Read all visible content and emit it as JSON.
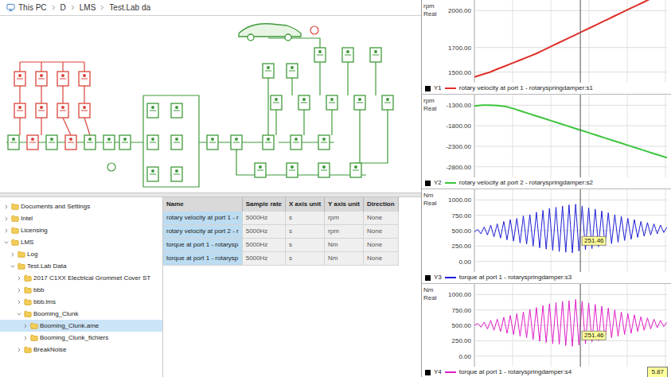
{
  "breadcrumb": [
    "This PC",
    "D",
    "LMS",
    "Test.Lab da"
  ],
  "tree": [
    {
      "label": "Documents and Settings",
      "depth": 0,
      "expanded": false,
      "selected": false
    },
    {
      "label": "Intel",
      "depth": 0,
      "expanded": false,
      "selected": false
    },
    {
      "label": "Licensing",
      "depth": 0,
      "expanded": false,
      "selected": false
    },
    {
      "label": "LMS",
      "depth": 0,
      "expanded": true,
      "selected": false
    },
    {
      "label": "Log",
      "depth": 1,
      "expanded": false,
      "selected": false
    },
    {
      "label": "Test.Lab Data",
      "depth": 1,
      "expanded": true,
      "selected": false
    },
    {
      "label": "2017 C1XX Electrical Grommet Cover ST",
      "depth": 2,
      "expanded": false,
      "selected": false
    },
    {
      "label": "bbb",
      "depth": 2,
      "expanded": false,
      "selected": false
    },
    {
      "label": "bbb.lms",
      "depth": 2,
      "expanded": false,
      "selected": false
    },
    {
      "label": "Booming_Clunk",
      "depth": 2,
      "expanded": true,
      "selected": false
    },
    {
      "label": "Booming_Clunk.ame",
      "depth": 3,
      "expanded": false,
      "selected": true
    },
    {
      "label": "Booming_Clunk_fichiers",
      "depth": 3,
      "expanded": false,
      "selected": false
    },
    {
      "label": "BreakNoise",
      "depth": 2,
      "expanded": false,
      "selected": false
    }
  ],
  "table": {
    "columns": [
      "Name",
      "Sample rate",
      "X axis unit",
      "Y axis unit",
      "Direction"
    ],
    "rows": [
      {
        "cells": [
          "rotary velocity at port 1 - r",
          "5000Hz",
          "s",
          "rpm",
          "None"
        ],
        "selected": true
      },
      {
        "cells": [
          "rotary velocity at port 2 - r",
          "5000Hz",
          "s",
          "rpm",
          "None"
        ],
        "selected": true
      },
      {
        "cells": [
          "torque at port 1 - rotarysp",
          "5000Hz",
          "s",
          "Nm",
          "None"
        ],
        "selected": true
      },
      {
        "cells": [
          "torque at port 1 - rotarysp",
          "5000Hz",
          "s",
          "Nm",
          "None"
        ],
        "selected": true
      }
    ]
  },
  "charts": [
    {
      "units": [
        "rpm",
        "Real"
      ],
      "ticks": [
        "2000.00",
        "1700.00",
        "1500.00"
      ],
      "legend_id": "Y1",
      "legend": "rotary velocity at port 1 - rotaryspringdamper:s1",
      "color": "#e0302a",
      "values": [
        1460,
        1480,
        1500,
        1525,
        1550,
        1575,
        1600,
        1625,
        1650,
        1680,
        1710,
        1740,
        1770,
        1800,
        1830,
        1860,
        1890,
        1920,
        1950,
        1980,
        2010,
        2040,
        2070,
        2100,
        2130,
        2160
      ]
    },
    {
      "units": [
        "rpm",
        "Real"
      ],
      "ticks": [
        "-1300.00",
        "-1800.00",
        "-2300.00",
        "-2800.00"
      ],
      "legend_id": "Y2",
      "legend": "rotary velocity at port 2 - rotaryspringdamper:s2",
      "color": "#3cc43c",
      "values": [
        -1320,
        -1300,
        -1300,
        -1310,
        -1330,
        -1380,
        -1440,
        -1500,
        -1560,
        -1620,
        -1680,
        -1740,
        -1800,
        -1860,
        -1920,
        -1980,
        -2040,
        -2100,
        -2160,
        -2220,
        -2280,
        -2340,
        -2400,
        -2460,
        -2520,
        -2580
      ]
    },
    {
      "units": [
        "Nm",
        "Real"
      ],
      "ticks": [
        "1000.00",
        "750.00",
        "500.00",
        "250.00",
        "0.00"
      ],
      "legend_id": "Y3",
      "legend": "torque at port 1 - rotaryspringdamper:s3",
      "color": "#1f1fd6",
      "marker": "251.46",
      "values": [
        480,
        520,
        450,
        560,
        430,
        590,
        400,
        610,
        380,
        650,
        350,
        680,
        330,
        700,
        300,
        740,
        280,
        760,
        250,
        800,
        220,
        830,
        200,
        860,
        180,
        880,
        160,
        900,
        150,
        920,
        140,
        930,
        170,
        900,
        190,
        870,
        210,
        850,
        240,
        820,
        260,
        790,
        290,
        760,
        310,
        730,
        340,
        700,
        360,
        680,
        390,
        650,
        410,
        630,
        430,
        610,
        450,
        590,
        470,
        560
      ]
    },
    {
      "units": [
        "Nm",
        "Real"
      ],
      "ticks": [
        "1000.00",
        "750.00",
        "500.00",
        "250.00",
        "0.00"
      ],
      "legend_id": "Y4",
      "legend": "torque at port 1 - rotaryspringdamper:s4",
      "color": "#e020c8",
      "marker": "251.46",
      "values": [
        500,
        530,
        470,
        550,
        440,
        580,
        420,
        600,
        400,
        630,
        370,
        660,
        350,
        690,
        320,
        720,
        300,
        760,
        270,
        790,
        240,
        820,
        220,
        850,
        200,
        870,
        190,
        890,
        170,
        900,
        160,
        920,
        180,
        890,
        200,
        860,
        230,
        840,
        250,
        810,
        270,
        780,
        300,
        750,
        320,
        720,
        350,
        690,
        370,
        670,
        400,
        640,
        420,
        620,
        440,
        600,
        460,
        580,
        480,
        550
      ]
    }
  ],
  "cursor": {
    "label": "5.87"
  }
}
